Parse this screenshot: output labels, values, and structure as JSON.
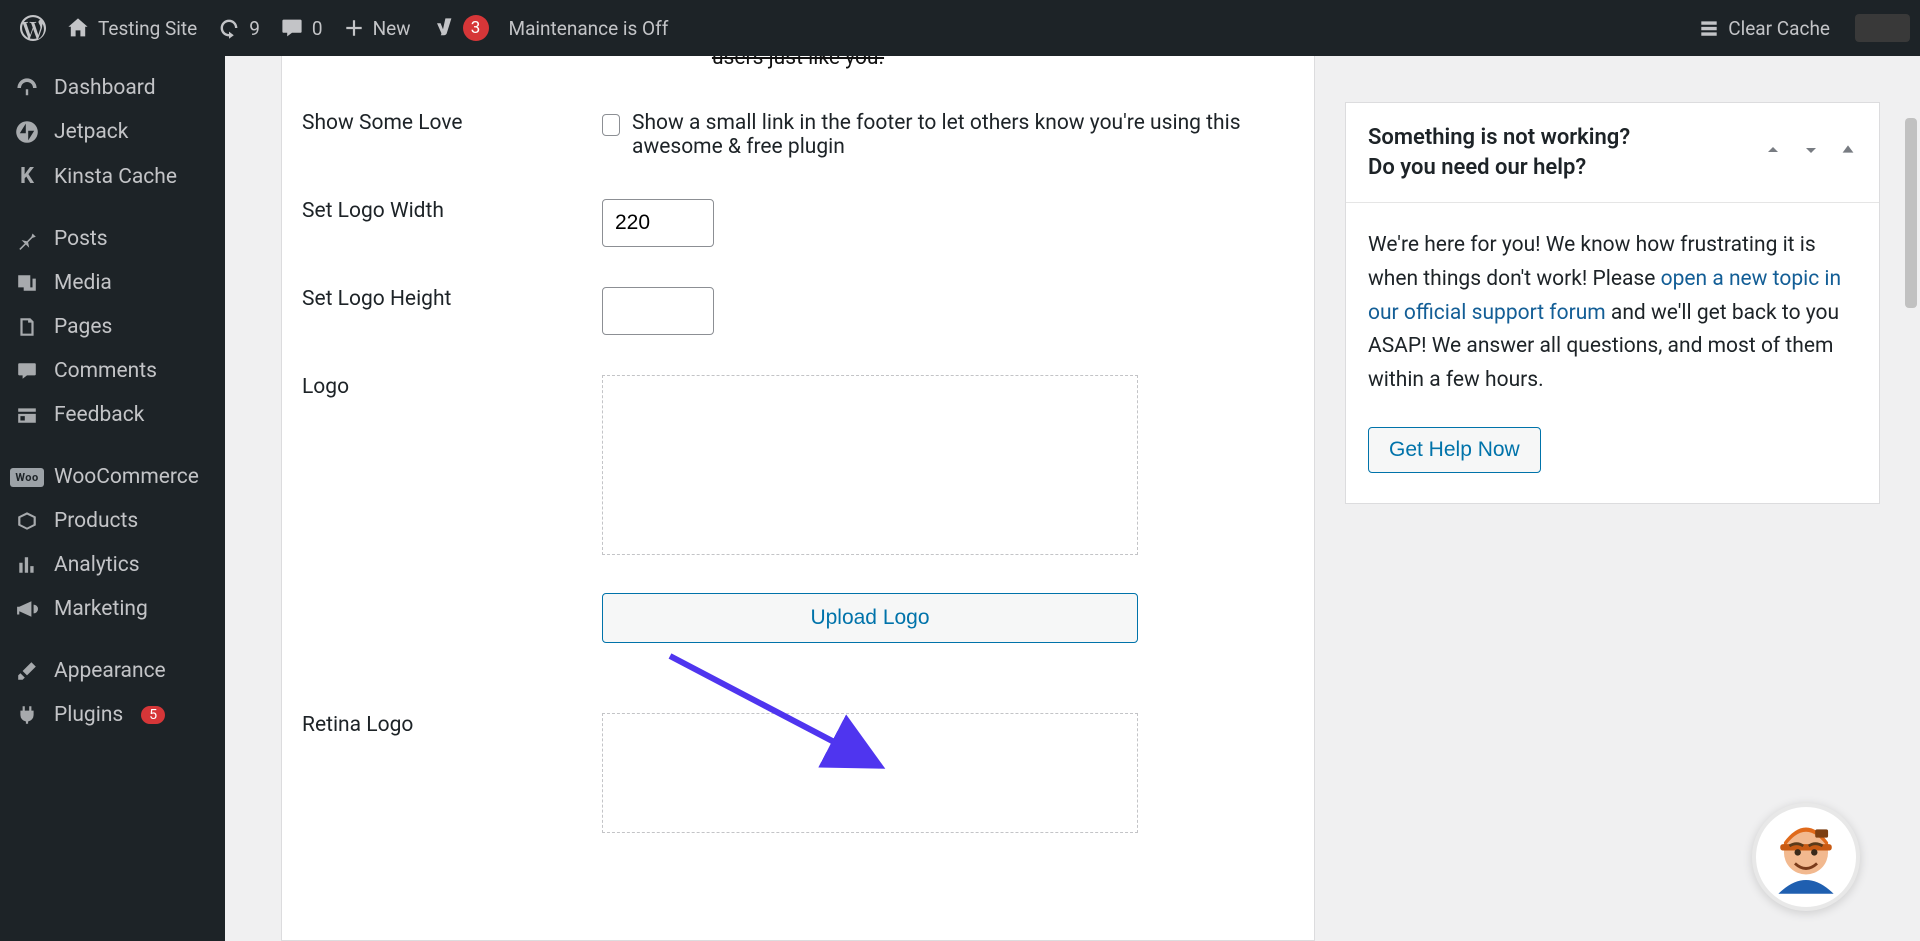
{
  "adminbar": {
    "site_name": "Testing Site",
    "updates": "9",
    "comments": "0",
    "new": "New",
    "yoast_count": "3",
    "maintenance": "Maintenance is Off",
    "clear_cache": "Clear Cache"
  },
  "sidebar": {
    "items": [
      {
        "label": "Dashboard"
      },
      {
        "label": "Jetpack"
      },
      {
        "label": "Kinsta Cache"
      },
      {
        "label": "Posts"
      },
      {
        "label": "Media"
      },
      {
        "label": "Pages"
      },
      {
        "label": "Comments"
      },
      {
        "label": "Feedback"
      },
      {
        "label": "WooCommerce"
      },
      {
        "label": "Products"
      },
      {
        "label": "Analytics"
      },
      {
        "label": "Marketing"
      },
      {
        "label": "Appearance"
      },
      {
        "label": "Plugins",
        "badge": "5"
      }
    ],
    "woo_badge": "Woo"
  },
  "form": {
    "top_cut": "users just like you.",
    "show_love": {
      "label": "Show Some Love",
      "desc": "Show a small link in the footer to let others know you're using this awesome & free plugin"
    },
    "logo_width": {
      "label": "Set Logo Width",
      "value": "220"
    },
    "logo_height": {
      "label": "Set Logo Height",
      "value": ""
    },
    "logo": {
      "label": "Logo",
      "upload": "Upload Logo"
    },
    "retina": {
      "label": "Retina Logo"
    }
  },
  "help_box": {
    "title_l1": "Something is not working?",
    "title_l2": "Do you need our help?",
    "body_1": "We're here for you! We know how frustrating it is when things don't work! Please ",
    "link": "open a new topic in our official support forum",
    "body_2": " and we'll get back to you ASAP! We answer all questions, and most of them within a few hours.",
    "button": "Get Help Now"
  }
}
